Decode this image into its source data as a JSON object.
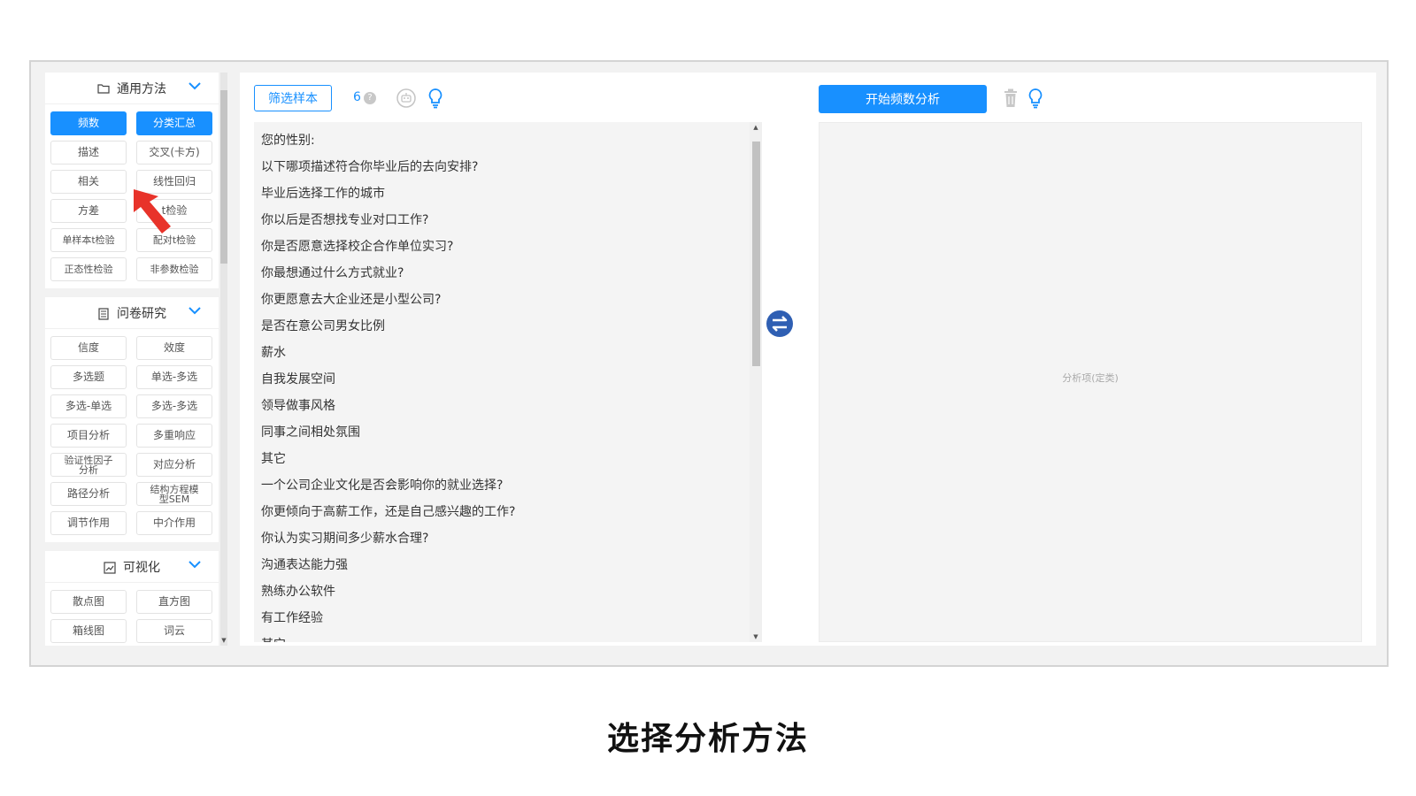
{
  "sidebar": {
    "sections": [
      {
        "title": "通用方法",
        "icon": "folder-icon",
        "buttons": [
          {
            "label": "频数",
            "active": true
          },
          {
            "label": "分类汇总",
            "active": true
          },
          {
            "label": "描述"
          },
          {
            "label": "交叉(卡方)"
          },
          {
            "label": "相关"
          },
          {
            "label": "线性回归"
          },
          {
            "label": "方差"
          },
          {
            "label": "t检验"
          },
          {
            "label": "单样本t检验"
          },
          {
            "label": "配对t检验"
          },
          {
            "label": "正态性检验"
          },
          {
            "label": "非参数检验"
          }
        ]
      },
      {
        "title": "问卷研究",
        "icon": "document-icon",
        "buttons": [
          {
            "label": "信度"
          },
          {
            "label": "效度"
          },
          {
            "label": "多选题"
          },
          {
            "label": "单选-多选"
          },
          {
            "label": "多选-单选"
          },
          {
            "label": "多选-多选"
          },
          {
            "label": "项目分析"
          },
          {
            "label": "多重响应"
          },
          {
            "label": "验证性因子分析"
          },
          {
            "label": "对应分析"
          },
          {
            "label": "路径分析"
          },
          {
            "label": "结构方程模型SEM"
          },
          {
            "label": "调节作用"
          },
          {
            "label": "中介作用"
          }
        ]
      },
      {
        "title": "可视化",
        "icon": "chart-icon",
        "buttons": [
          {
            "label": "散点图"
          },
          {
            "label": "直方图"
          },
          {
            "label": "箱线图"
          },
          {
            "label": "词云"
          }
        ]
      }
    ]
  },
  "toolbar": {
    "filter_label": "筛选样本",
    "count": "6",
    "help_glyph": "?",
    "start_label": "开始频数分析"
  },
  "variables": [
    "您的性别:",
    "以下哪项描述符合你毕业后的去向安排?",
    "毕业后选择工作的城市",
    "你以后是否想找专业对口工作?",
    "你是否愿意选择校企合作单位实习?",
    "你最想通过什么方式就业?",
    "你更愿意去大企业还是小型公司?",
    "是否在意公司男女比例",
    "薪水",
    "自我发展空间",
    "领导做事风格",
    "同事之间相处氛围",
    "其它",
    "一个公司企业文化是否会影响你的就业选择?",
    "你更倾向于高薪工作，还是自己感兴趣的工作?",
    "你认为实习期间多少薪水合理?",
    "沟通表达能力强",
    "熟练办公软件",
    "有工作经验",
    "其它"
  ],
  "drop_area": {
    "hint": "分析项(定类)"
  },
  "caption": "选择分析方法",
  "colors": {
    "accent": "#1890ff",
    "swap": "#2f5fb3",
    "cursor": "#e8332a"
  }
}
